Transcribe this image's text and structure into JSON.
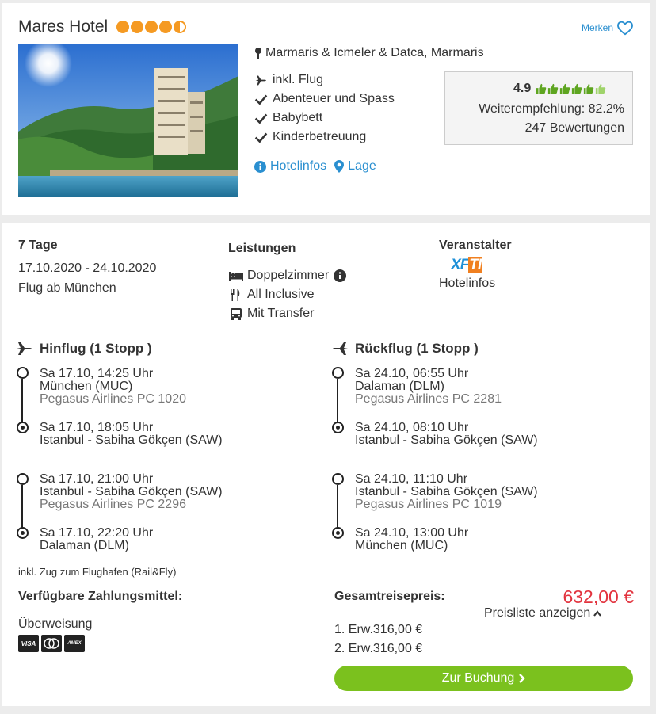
{
  "hotel": {
    "name": "Mares Hotel",
    "stars": 4.5,
    "merken_label": "Merken",
    "location": "Marmaris & Icmeler & Datca, Marmaris",
    "features": [
      "inkl. Flug",
      "Abenteuer und Spass",
      "Babybett",
      "Kinderbetreuung"
    ],
    "links": {
      "hotelinfos": "Hotelinfos",
      "lage": "Lage"
    },
    "rating": {
      "score": "4.9",
      "thumbs": 6,
      "recommendation": "Weiterempfehlung: 82.2%",
      "reviews": "247 Bewertungen"
    }
  },
  "trip": {
    "duration": "7 Tage",
    "dates": "17.10.2020 - 24.10.2020",
    "departure": "Flug ab München",
    "leistungen_title": "Leistungen",
    "leistungen": [
      "Doppelzimmer",
      "All Inclusive",
      "Mit Transfer"
    ],
    "veranstalter_title": "Veranstalter",
    "veranstalter_logo": "XFTI",
    "veranstalter_link": "Hotelinfos"
  },
  "outbound": {
    "title": "Hinflug (1 Stopp )",
    "segments": [
      {
        "dep_time": "Sa 17.10, 14:25 Uhr",
        "dep_airport": "München (MUC)",
        "airline": "Pegasus Airlines PC 1020",
        "arr_time": "Sa 17.10, 18:05 Uhr",
        "arr_airport": "Istanbul - Sabiha Gökçen (SAW)"
      },
      {
        "dep_time": "Sa 17.10, 21:00 Uhr",
        "dep_airport": "Istanbul - Sabiha Gökçen (SAW)",
        "airline": "Pegasus Airlines PC 2296",
        "arr_time": "Sa 17.10, 22:20 Uhr",
        "arr_airport": "Dalaman (DLM)"
      }
    ]
  },
  "inbound": {
    "title": "Rückflug (1 Stopp )",
    "segments": [
      {
        "dep_time": "Sa 24.10, 06:55 Uhr",
        "dep_airport": "Dalaman (DLM)",
        "airline": "Pegasus Airlines PC 2281",
        "arr_time": "Sa 24.10, 08:10 Uhr",
        "arr_airport": "Istanbul - Sabiha Gökçen (SAW)"
      },
      {
        "dep_time": "Sa 24.10, 11:10 Uhr",
        "dep_airport": "Istanbul - Sabiha Gökçen (SAW)",
        "airline": "Pegasus Airlines PC 1019",
        "arr_time": "Sa 24.10, 13:00 Uhr",
        "arr_airport": "München (MUC)"
      }
    ]
  },
  "rail": "inkl. Zug zum Flughafen (Rail&Fly)",
  "payment": {
    "title": "Verfügbare Zahlungsmittel:",
    "method": "Überweisung",
    "cards": [
      "VISA",
      "mastercard",
      "AMEX"
    ]
  },
  "pricing": {
    "title": "Gesamtreisepreis:",
    "total": "632,00 €",
    "preisliste": "Preisliste anzeigen",
    "lines": [
      "1. Erw.316,00 €",
      "2. Erw.316,00 €"
    ],
    "book_label": "Zur Buchung"
  },
  "colors": {
    "accent": "#2a8fd0",
    "price": "#e2333e",
    "button": "#7bc11e",
    "star": "#f59a23",
    "thumb": "#5ea520"
  }
}
